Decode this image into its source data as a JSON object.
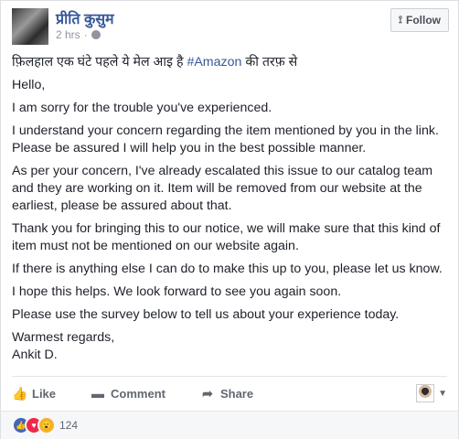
{
  "post": {
    "author": "प्रीति कुसुम",
    "timestamp": "2 hrs",
    "separator": "·",
    "follow_label": "Follow",
    "intro_prefix": "फ़िलहाल एक घंटे पहले ये मेल आइ है",
    "hashtag": "#Amazon",
    "intro_suffix": "की तरफ़ से",
    "paragraphs": [
      "Hello,",
      "I am sorry for the trouble you've experienced.",
      "I understand your concern regarding the item mentioned by you in the link. Please be assured I will help you in the best possible manner.",
      "As per your concern, I've already escalated this issue to our catalog team and they are working on it. Item will be removed from our website at the earliest, please be assured about that.",
      "Thank you for bringing this to our notice, we will make sure that this kind of item must not be mentioned on our website again.",
      "If there is anything else I can do to make this up to you, please let us know.",
      "I hope this helps. We look forward to see you again soon.",
      "Please use the survey below to tell us about your experience today."
    ],
    "signoff": "Warmest regards,",
    "signature": "Ankit D."
  },
  "actions": {
    "like": "Like",
    "comment": "Comment",
    "share": "Share"
  },
  "reactions": {
    "count": "124",
    "icons": [
      "like-icon",
      "love-icon",
      "wow-icon"
    ]
  },
  "colors": {
    "link": "#365899",
    "text": "#1d2129",
    "muted": "#90949c",
    "like": "#4267b2",
    "love": "#f0284a",
    "wow": "#f7b125"
  }
}
